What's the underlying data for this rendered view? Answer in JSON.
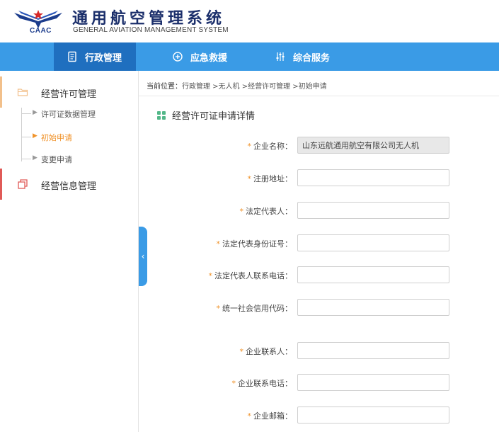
{
  "header": {
    "logo_text": "CAAC",
    "title": "通用航空管理系统",
    "subtitle": "GENERAL AVIATION MANAGEMENT SYSTEM"
  },
  "nav": {
    "items": [
      {
        "label": "行政管理",
        "icon": "document-icon",
        "active": true
      },
      {
        "label": "应急救援",
        "icon": "plus-circle-icon",
        "active": false
      },
      {
        "label": "综合服务",
        "icon": "sliders-icon",
        "active": false
      }
    ]
  },
  "sidebar": {
    "groups": [
      {
        "label": "经营许可管理",
        "icon": "folder-icon",
        "accent": "#f2c08b",
        "items": [
          {
            "label": "许可证数据管理",
            "active": false
          },
          {
            "label": "初始申请",
            "active": true
          },
          {
            "label": "变更申请",
            "active": false
          }
        ]
      },
      {
        "label": "经营信息管理",
        "icon": "copy-icon",
        "accent": "#e05a57"
      }
    ]
  },
  "breadcrumb": {
    "label": "当前位置：",
    "path": "行政管理 >无人机 >经营许可管理 >初始申请"
  },
  "section": {
    "title": "经营许可证申请详情"
  },
  "form": {
    "fields": [
      {
        "label": "企业名称：",
        "value": "山东远航通用航空有限公司无人机",
        "disabled": true
      },
      {
        "label": "注册地址：",
        "value": ""
      },
      {
        "label": "法定代表人：",
        "value": ""
      },
      {
        "label": "法定代表身份证号：",
        "value": ""
      },
      {
        "label": "法定代表人联系电话：",
        "value": ""
      },
      {
        "label": "统一社会信用代码：",
        "value": ""
      },
      {
        "label": "企业联系人：",
        "value": ""
      },
      {
        "label": "企业联系电话：",
        "value": ""
      },
      {
        "label": "企业邮箱：",
        "value": ""
      }
    ],
    "required_mark": "*"
  },
  "colors": {
    "nav_bg": "#3a9be6",
    "nav_active": "#1f6fbf",
    "accent_orange": "#f0932b",
    "section_icon": "#52b788"
  }
}
